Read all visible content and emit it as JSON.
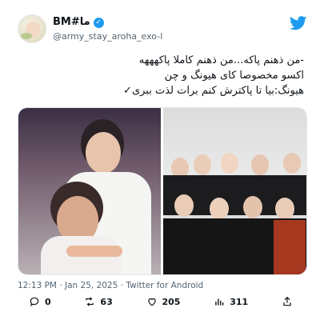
{
  "account": {
    "display_name": "BM#ما",
    "handle": "@army_stay_aroha_exo-l"
  },
  "tweet": {
    "lines": [
      "-من ذهنم پاکه...من ذهنم کاملا پاکهههه",
      "اکسو مخصوصا کای هیونگ و چن",
      "هیونگ:بیا تا پاکترش کنم برات لذت ببری✓"
    ]
  },
  "meta": {
    "time": "12:13 PM",
    "sep1": " · ",
    "date": "Jan 25, 2025",
    "sep2": " · ",
    "client": "Twitter for Android"
  },
  "actions": {
    "replies": "0",
    "retweets": "63",
    "likes": "205",
    "views": "311"
  },
  "colors": {
    "accent": "#1d9bf0",
    "secondary_text": "#536471"
  },
  "icons": {
    "verified": "verified-badge-icon",
    "brand": "twitter-bird-icon",
    "reply": "reply-icon",
    "retweet": "retweet-icon",
    "like": "heart-icon",
    "views": "views-icon",
    "share": "share-icon"
  }
}
